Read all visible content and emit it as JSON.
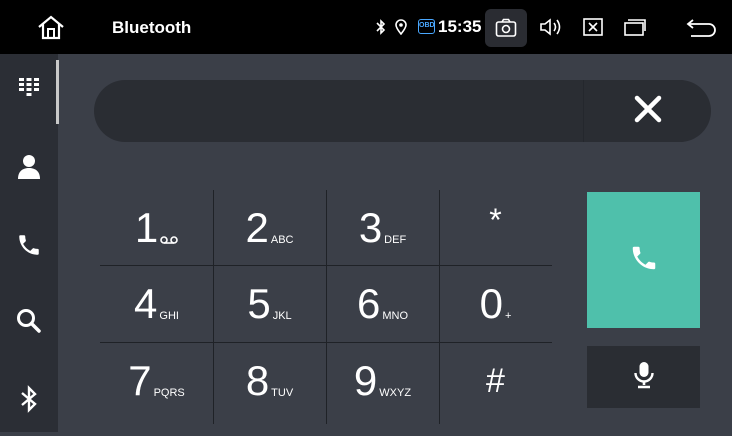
{
  "statusbar": {
    "title": "Bluetooth",
    "time": "15:35",
    "obd_label": "OBD"
  },
  "sidebar": {
    "items": [
      {
        "name": "keypad-icon"
      },
      {
        "name": "contacts-icon"
      },
      {
        "name": "call-log-icon"
      },
      {
        "name": "search-icon"
      },
      {
        "name": "bluetooth-icon"
      }
    ]
  },
  "dialer": {
    "number_value": "",
    "keys": [
      {
        "digit": "1",
        "letters": ""
      },
      {
        "digit": "2",
        "letters": "ABC"
      },
      {
        "digit": "3",
        "letters": "DEF"
      },
      {
        "digit": "*",
        "letters": ""
      },
      {
        "digit": "4",
        "letters": "GHI"
      },
      {
        "digit": "5",
        "letters": "JKL"
      },
      {
        "digit": "6",
        "letters": "MNO"
      },
      {
        "digit": "0",
        "letters": "+"
      },
      {
        "digit": "7",
        "letters": "PQRS"
      },
      {
        "digit": "8",
        "letters": "TUV"
      },
      {
        "digit": "9",
        "letters": "WXYZ"
      },
      {
        "digit": "#",
        "letters": ""
      }
    ]
  },
  "colors": {
    "call_button": "#4fc0ab",
    "background": "#3b3f48"
  }
}
